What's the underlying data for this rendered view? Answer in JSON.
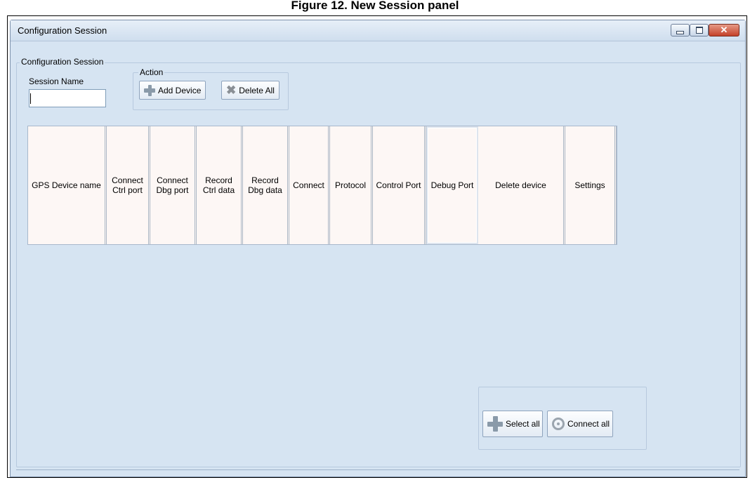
{
  "figure_caption": "Figure 12. New Session panel",
  "window": {
    "title": "Configuration Session",
    "controls": {
      "minimize": "",
      "maximize": "",
      "close": "✕"
    }
  },
  "session_group": {
    "label": "Configuration Session",
    "session_name_label": "Session Name",
    "session_name_value": ""
  },
  "action_group": {
    "label": "Action",
    "add_device": "Add Device",
    "delete_all": "Delete All"
  },
  "table": {
    "columns": [
      "GPS Device name",
      "Connect\nCtrl port",
      "Connect\nDbg port",
      "Record\nCtrl data",
      "Record\nDbg data",
      "Connect",
      "Protocol",
      "Control Port",
      "Debug Port",
      "Delete device",
      "Settings"
    ]
  },
  "bottom_actions": {
    "select_all": "Select all",
    "connect_all": "Connect all"
  },
  "colors": {
    "window_bg": "#d6e4f2",
    "close_button": "#c4412a",
    "header_cell_bg": "#fdf7f5"
  }
}
